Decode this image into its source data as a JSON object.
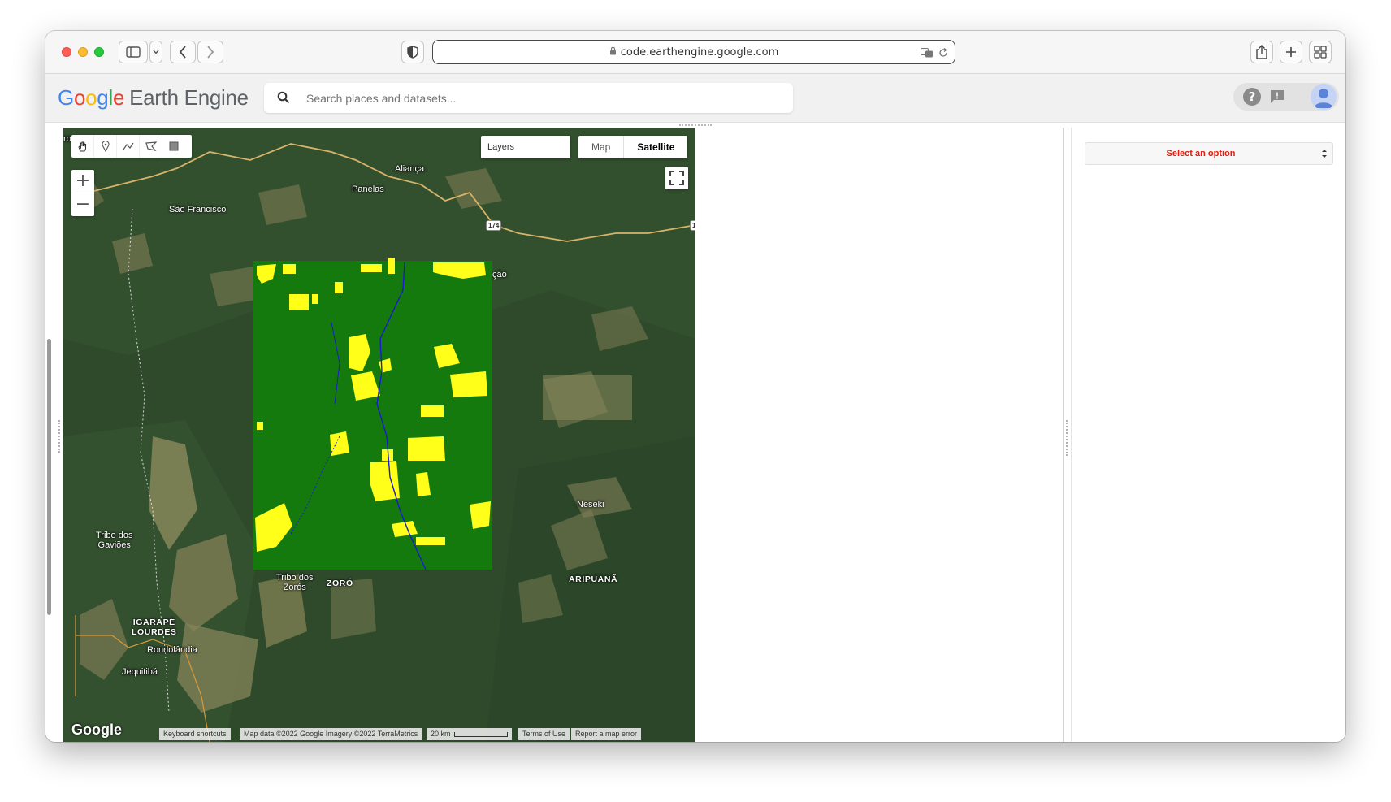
{
  "browser": {
    "url": "code.earthengine.google.com"
  },
  "header": {
    "logo_google": "Google",
    "logo_product": "Earth Engine",
    "search_placeholder": "Search places and datasets..."
  },
  "map": {
    "layers_label": "Layers",
    "maptype_map": "Map",
    "maptype_satellite": "Satellite",
    "maptype_selected": "Satellite",
    "zoom_in": "+",
    "zoom_out": "−",
    "labels": {
      "alianca": "Aliança",
      "panelas": "Panelas",
      "sao_francisco": "São Francisco",
      "cao": "ção",
      "road_174": "174",
      "road_1": "1",
      "neseki": "Neseki",
      "tribo_gavioes_1": "Tribo dos",
      "tribo_gavioes_2": "Gaviões",
      "tribo_zoros_1": "Tribo dos",
      "tribo_zoros_2": "Zorós",
      "zoro": "ZORÓ",
      "aripuana": "ARIPUANÃ",
      "igarape_1": "IGARAPÉ",
      "igarape_2": "LOURDES",
      "rondolandia": "Rondolândia",
      "jequitiba": "Jequitibá",
      "edge_ro": "ro"
    },
    "google_logo": "Google",
    "attribution": {
      "keyboard": "Keyboard shortcuts",
      "mapdata": "Map data ©2022 Google Imagery ©2022 TerraMetrics",
      "scale": "20 km",
      "terms": "Terms of Use",
      "report": "Report a map error"
    },
    "classification_colors": {
      "forest": "#157a0e",
      "deforested": "#ffff1a",
      "water": "#1a1ad0"
    }
  },
  "right_panel": {
    "select_value": "Select an option",
    "select_color": "#e8180c"
  }
}
